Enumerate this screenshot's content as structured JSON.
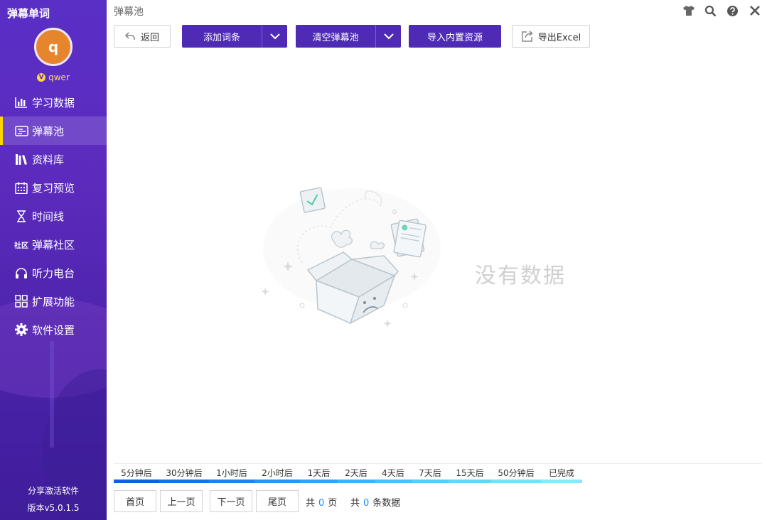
{
  "app_title": "弹幕单词",
  "user": {
    "avatar_letter": "q",
    "vip_badge": "V",
    "name": "qwer"
  },
  "nav": [
    {
      "label": "学习数据",
      "icon": "bar-chart-icon"
    },
    {
      "label": "弹幕池",
      "icon": "danmaku-icon",
      "active": true
    },
    {
      "label": "资料库",
      "icon": "books-icon"
    },
    {
      "label": "复习预览",
      "icon": "calendar-icon"
    },
    {
      "label": "时间线",
      "icon": "hourglass-icon"
    },
    {
      "label": "弹幕社区",
      "icon": "community-icon",
      "icon_text": "社区"
    },
    {
      "label": "听力电台",
      "icon": "headphones-icon"
    },
    {
      "label": "扩展功能",
      "icon": "grid-icon"
    },
    {
      "label": "软件设置",
      "icon": "gear-icon"
    }
  ],
  "footer": {
    "share": "分享激活软件",
    "version": "版本v5.0.1.5"
  },
  "header": {
    "page_title": "弹幕池"
  },
  "toolbar": {
    "back": "返回",
    "add_entry": "添加词条",
    "clear_pool": "清空弹幕池",
    "import_builtin": "导入内置资源",
    "export_excel": "导出Excel"
  },
  "empty_state": {
    "text": "没有数据"
  },
  "legend": [
    {
      "label": "5分钟后",
      "color": "#1160e0"
    },
    {
      "label": "30分钟后",
      "color": "#1a72e6"
    },
    {
      "label": "1小时后",
      "color": "#2183ea"
    },
    {
      "label": "2小时后",
      "color": "#2a94ef"
    },
    {
      "label": "1天后",
      "color": "#34a4f2"
    },
    {
      "label": "2天后",
      "color": "#3eb3f5"
    },
    {
      "label": "4天后",
      "color": "#4ac0f7"
    },
    {
      "label": "7天后",
      "color": "#58cbf8"
    },
    {
      "label": "15天后",
      "color": "#66d5fa"
    },
    {
      "label": "50分钟后",
      "color": "#78defb"
    },
    {
      "label": "已完成",
      "color": "#8ae8fc"
    }
  ],
  "pager": {
    "first": "首页",
    "prev": "上一页",
    "next": "下一页",
    "last": "尾页",
    "pages_prefix": "共",
    "pages_count": "0",
    "pages_suffix": "页",
    "records_prefix": "共",
    "records_count": "0",
    "records_suffix": "条数据"
  }
}
